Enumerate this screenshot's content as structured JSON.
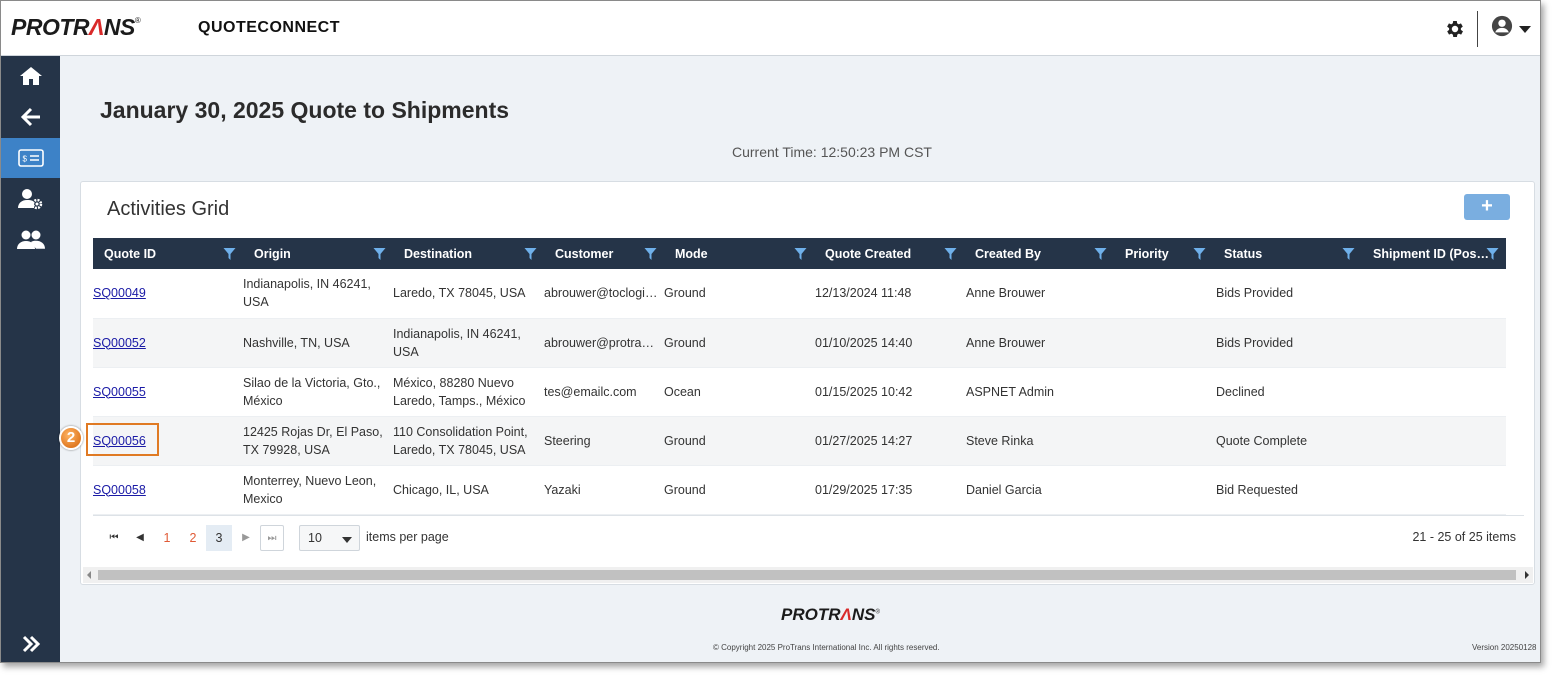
{
  "header": {
    "logo_pre": "PRO",
    "logo_a": "TR",
    "logo_accent": "Λ",
    "logo_post": "NS",
    "logo_reg": "®",
    "app_title": "QUOTECONNECT"
  },
  "sidebar": {
    "items": [
      {
        "icon": "home-icon"
      },
      {
        "icon": "back-arrow-icon"
      },
      {
        "icon": "quote-icon",
        "active": true
      },
      {
        "icon": "user-settings-icon"
      },
      {
        "icon": "users-icon"
      }
    ],
    "expand_icon": "double-chevron-right-icon"
  },
  "page": {
    "title": "January 30, 2025 Quote to Shipments",
    "current_time": "Current Time: 12:50:23 PM CST"
  },
  "grid": {
    "title": "Activities Grid",
    "add_label": "+",
    "columns": [
      "Quote ID",
      "Origin",
      "Destination",
      "Customer",
      "Mode",
      "Quote Created",
      "Created By",
      "Priority",
      "Status",
      "Shipment ID (Pos…"
    ],
    "rows": [
      {
        "quote_id": "SQ00049",
        "origin": "Indianapolis, IN 46241, USA",
        "destination": "Laredo, TX 78045, USA",
        "customer": "abrouwer@toclogis…",
        "mode": "Ground",
        "created": "12/13/2024 11:48",
        "created_by": "Anne Brouwer",
        "priority": "",
        "status": "Bids Provided",
        "shipment_id": ""
      },
      {
        "quote_id": "SQ00052",
        "origin": "Nashville, TN, USA",
        "destination": "Indianapolis, IN 46241, USA",
        "customer": "abrouwer@protran…",
        "mode": "Ground",
        "created": "01/10/2025 14:40",
        "created_by": "Anne Brouwer",
        "priority": "",
        "status": "Bids Provided",
        "shipment_id": ""
      },
      {
        "quote_id": "SQ00055",
        "origin": "Silao de la Victoria, Gto., México",
        "destination": "México, 88280 Nuevo Laredo, Tamps., México",
        "customer": "tes@emailc.com",
        "mode": "Ocean",
        "created": "01/15/2025 10:42",
        "created_by": "ASPNET Admin",
        "priority": "",
        "status": "Declined",
        "shipment_id": ""
      },
      {
        "quote_id": "SQ00056",
        "origin": "12425 Rojas Dr, El Paso, TX 79928, USA",
        "destination": "110 Consolidation Point, Laredo, TX 78045, USA",
        "customer": "Steering",
        "mode": "Ground",
        "created": "01/27/2025 14:27",
        "created_by": "Steve Rinka",
        "priority": "",
        "status": "Quote Complete",
        "shipment_id": ""
      },
      {
        "quote_id": "SQ00058",
        "origin": "Monterrey, Nuevo Leon, Mexico",
        "destination": "Chicago, IL, USA",
        "customer": "Yazaki",
        "mode": "Ground",
        "created": "01/29/2025 17:35",
        "created_by": "Daniel Garcia",
        "priority": "",
        "status": "Bid Requested",
        "shipment_id": ""
      }
    ],
    "annotation_badge": "2"
  },
  "pager": {
    "first": "⏮",
    "prev": "◀",
    "pages": [
      "1",
      "2",
      "3"
    ],
    "current_page": "3",
    "next": "▶",
    "last": "⏭",
    "page_size": "10",
    "items_per_page": "items per page",
    "range": "21 - 25 of 25 items"
  },
  "footer": {
    "copyright": "© Copyright 2025 ProTrans International Inc. All rights reserved.",
    "version": "Version 20250128"
  },
  "colors": {
    "sidebar": "#253448",
    "active": "#3d82c7",
    "accent_red": "#d92a2a",
    "highlight": "#e07a23",
    "link": "#1a1aa6"
  }
}
